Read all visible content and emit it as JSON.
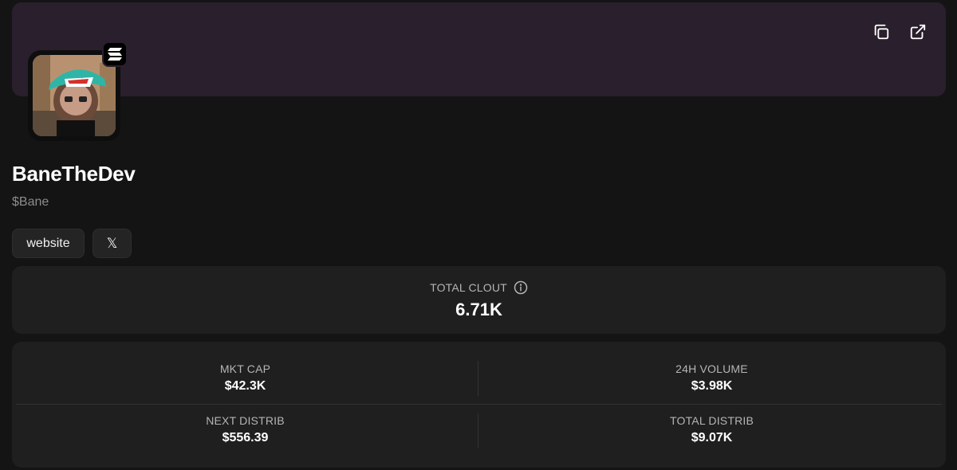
{
  "profile": {
    "name": "BaneTheDev",
    "ticker": "$Bane",
    "avatar_alt": "Token avatar",
    "chain_icon": "solana-icon"
  },
  "banner": {
    "color": "#2a1f2c",
    "actions": [
      {
        "icon": "copy-icon"
      },
      {
        "icon": "external-link-icon"
      }
    ]
  },
  "links": {
    "website_label": "website",
    "x_label": "𝕏"
  },
  "clout": {
    "label": "TOTAL CLOUT",
    "value": "6.71K",
    "info_icon": "info-icon"
  },
  "stats": {
    "mkt_cap": {
      "label": "MKT CAP",
      "value": "$42.3K"
    },
    "volume_24h": {
      "label": "24H VOLUME",
      "value": "$3.98K"
    },
    "next_distrib": {
      "label": "NEXT DISTRIB",
      "value": "$556.39"
    },
    "total_distrib": {
      "label": "TOTAL DISTRIB",
      "value": "$9.07K"
    }
  },
  "colors": {
    "background": "#141414",
    "card": "#1f1f1f",
    "muted_text": "#8c8c8c"
  }
}
